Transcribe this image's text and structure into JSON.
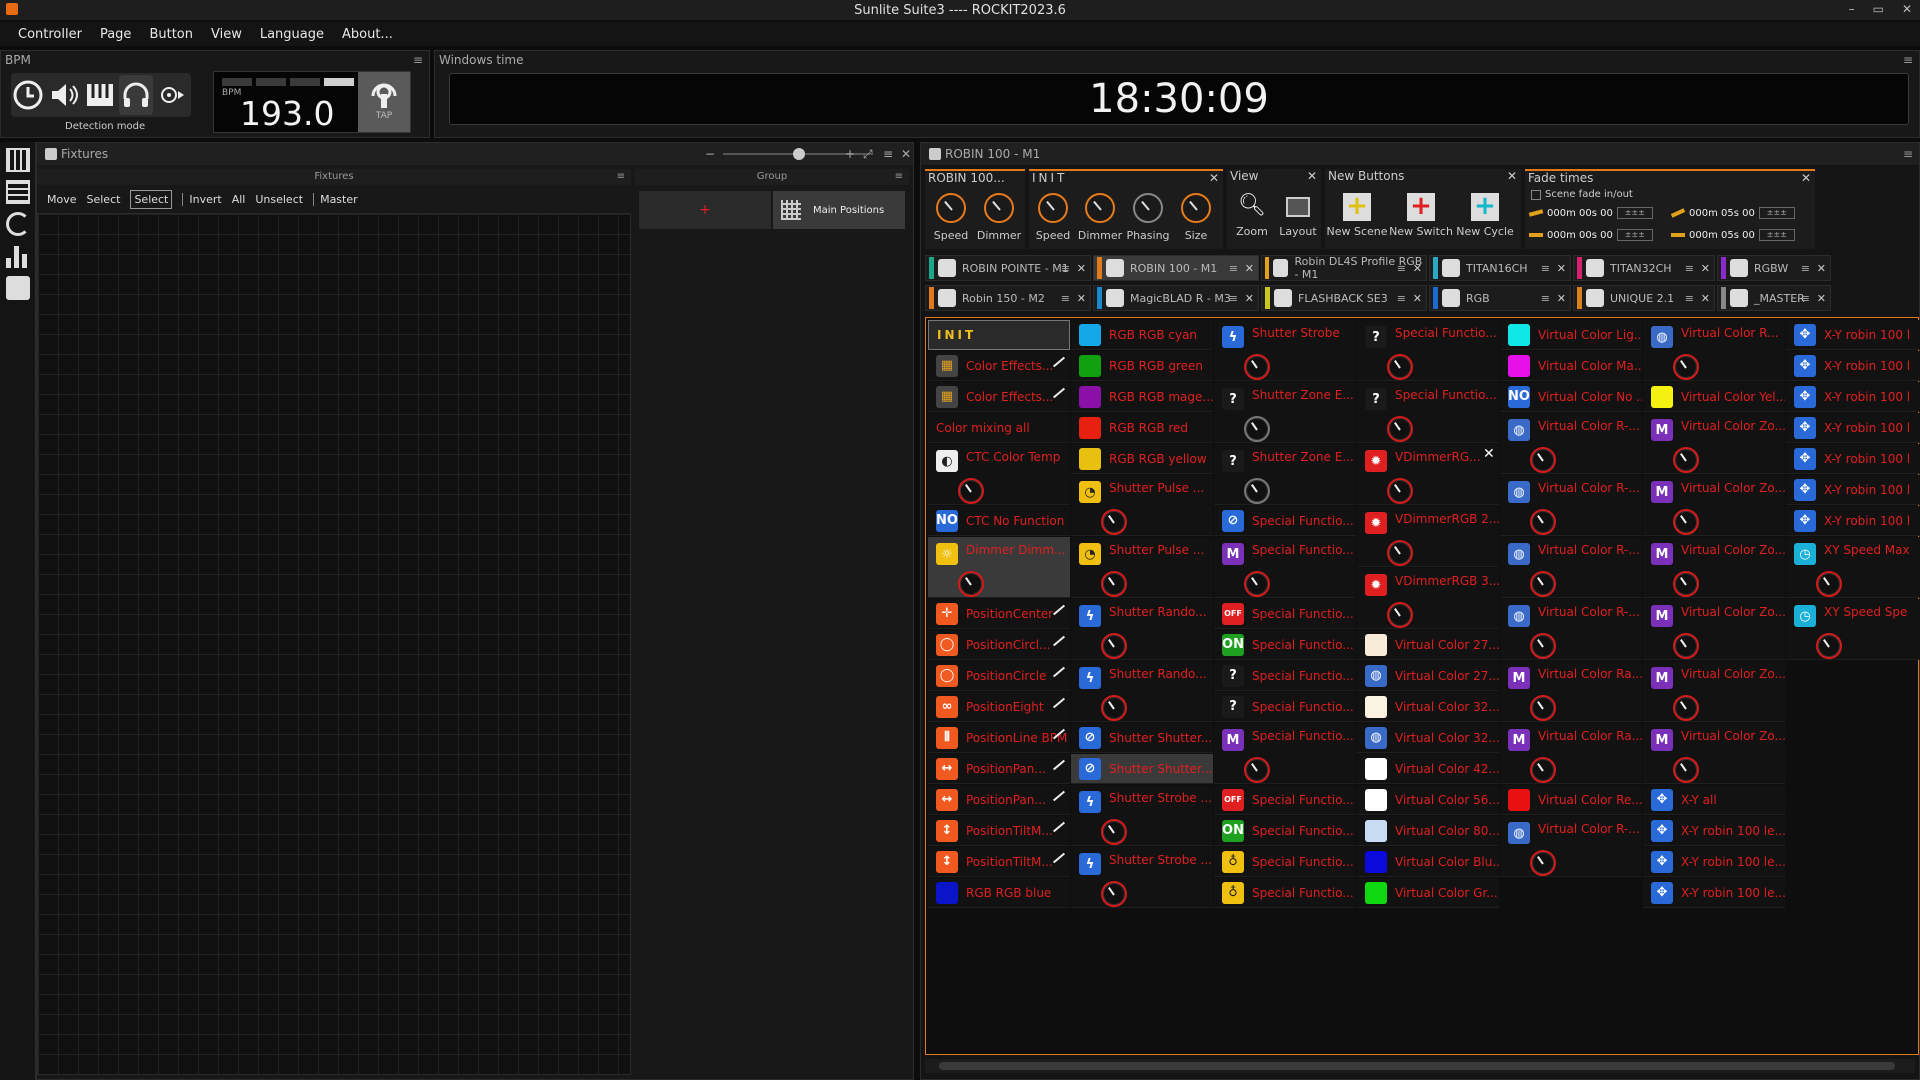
{
  "window": {
    "title": "Sunlite Suite3 ---- ROCKIT2023.6",
    "controls": [
      "–",
      "▭",
      "✕"
    ]
  },
  "menu": [
    "Controller",
    "Page",
    "Button",
    "View",
    "Language",
    "About..."
  ],
  "bpm": {
    "title": "BPM",
    "value": "193.0",
    "small_label": "BPM",
    "detection_label": "Detection mode",
    "tap": "TAP"
  },
  "clock": {
    "title": "Windows time",
    "time": "18:30:09"
  },
  "fixtures": {
    "title": "Fixtures",
    "grid_title": "Fixtures",
    "group_title": "Group",
    "toolbar": [
      "Move",
      "Select",
      "Select",
      "Invert",
      "All",
      "Unselect",
      "Master"
    ],
    "group_button": "Main Positions",
    "group_plus": "+",
    "zoom_minus": "−",
    "zoom_plus": "+"
  },
  "robin": {
    "title": "ROBIN 100 - M1"
  },
  "sections": [
    {
      "title": "ROBIN 100...",
      "knobs": [
        "Speed",
        "Dimmer"
      ]
    },
    {
      "title": "INIT",
      "knobs": [
        "Speed",
        "Dimmer",
        "Phasing",
        "Size"
      ]
    },
    {
      "title": "View",
      "knobs": [
        "Zoom",
        "Layout"
      ]
    },
    {
      "title": "New Buttons",
      "knobs": [
        "New Scene",
        "New Switch",
        "New Cycle"
      ]
    },
    {
      "title": "Fade times",
      "scene_fade": "Scene fade in/out",
      "times": [
        "000m 00s 00",
        "000m 05s 00",
        "000m 00s 00",
        "000m 05s 00"
      ]
    }
  ],
  "tabs_row1": [
    {
      "label": "ROBIN POINTE - M1",
      "color": "#1aa88a"
    },
    {
      "label": "ROBIN 100 - M1",
      "color": "#e07a1a"
    },
    {
      "label": "Robin DL4S Profile RGB - M1",
      "color": "#e0a01a"
    },
    {
      "label": "TITAN16CH",
      "color": "#2aa8c8"
    },
    {
      "label": "TITAN32CH",
      "color": "#d82070"
    },
    {
      "label": "RGBW",
      "color": "#8a2ad0"
    }
  ],
  "tabs_row2": [
    {
      "label": "Robin 150 - M2",
      "color": "#e07a1a"
    },
    {
      "label": "MagicBLAD R - M3",
      "color": "#1a8ad0"
    },
    {
      "label": "FLASHBACK SE3",
      "color": "#c8c820"
    },
    {
      "label": "RGB",
      "color": "#1a6ad0"
    },
    {
      "label": "UNIQUE 2.1",
      "color": "#d8801a"
    },
    {
      "label": "_MASTER",
      "color": "#888888"
    }
  ],
  "col1": [
    {
      "label": "INIT",
      "type": "init"
    },
    {
      "label": "Color Effects...",
      "icon": "grid-icon",
      "pen": true
    },
    {
      "label": "Color Effects...",
      "icon": "grid-icon",
      "pen": true
    },
    {
      "label": "Color mixing all"
    },
    {
      "label": "CTC Color Temp",
      "icon": "ctc-icon",
      "knob": true
    },
    {
      "label": "CTC No Function",
      "icon": "no-func-icon"
    },
    {
      "label": "Dimmer Dimm...",
      "icon": "dimmer-icon",
      "knob": true,
      "hi": true
    },
    {
      "label": "PositionCenter",
      "icon": "position-icon",
      "pen": true
    },
    {
      "label": "PositionCircl...",
      "icon": "circle-icon",
      "pen": true
    },
    {
      "label": "PositionCircle",
      "icon": "circle-icon",
      "pen": true
    },
    {
      "label": "PositionEight",
      "icon": "eight-icon",
      "pen": true
    },
    {
      "label": "PositionLine BPM",
      "icon": "line-icon",
      "pen": true
    },
    {
      "label": "PositionPan...",
      "icon": "pan-icon",
      "pen": true
    },
    {
      "label": "PositionPan...",
      "icon": "pan-icon",
      "pen": true
    },
    {
      "label": "PositionTiltM...",
      "icon": "tilt-icon",
      "pen": true
    },
    {
      "label": "PositionTiltM...",
      "icon": "tilt-icon",
      "pen": true
    },
    {
      "label": "RGB RGB blue",
      "icon": "swatch-icon",
      "color": "#0a14c8"
    }
  ],
  "col2": [
    {
      "label": "RGB RGB cyan",
      "color": "#14a8e8"
    },
    {
      "label": "RGB RGB green",
      "color": "#10a010"
    },
    {
      "label": "RGB RGB mage...",
      "color": "#8a10a8"
    },
    {
      "label": "RGB RGB red",
      "color": "#e82010"
    },
    {
      "label": "RGB RGB yellow",
      "color": "#e8c010"
    },
    {
      "label": "Shutter Pulse ...",
      "icon": "pulse-icon",
      "knob": true
    },
    {
      "label": "Shutter Pulse ...",
      "icon": "pulse-icon",
      "knob": true
    },
    {
      "label": "Shutter Rando...",
      "icon": "strobe-icon",
      "knob": true
    },
    {
      "label": "Shutter Rando...",
      "icon": "strobe-icon",
      "knob": true
    },
    {
      "label": "Shutter Shutter...",
      "icon": "shutter-icon"
    },
    {
      "label": "Shutter Shutter...",
      "icon": "shutter-icon",
      "hi": true
    },
    {
      "label": "Shutter Strobe ...",
      "icon": "strobe-icon",
      "knob": true
    },
    {
      "label": "Shutter Strobe ...",
      "icon": "strobe-icon",
      "knob": true
    }
  ],
  "col3": [
    {
      "label": "Shutter Strobe",
      "icon": "strobe-icon",
      "knob": true
    },
    {
      "label": "Shutter Zone E...",
      "icon": "question-icon",
      "knob": true
    },
    {
      "label": "Shutter Zone E...",
      "icon": "question-icon",
      "knob": true
    },
    {
      "label": "Special Functio...",
      "icon": "special-icon"
    },
    {
      "label": "Special Functio...",
      "icon": "macro-icon",
      "knob": true
    },
    {
      "label": "Special Functio...",
      "icon": "off-icon"
    },
    {
      "label": "Special Functio...",
      "icon": "on-icon"
    },
    {
      "label": "Special Functio...",
      "icon": "question-icon"
    },
    {
      "label": "Special Functio...",
      "icon": "question-icon"
    },
    {
      "label": "Special Functio...",
      "icon": "macro-icon",
      "knob": true
    },
    {
      "label": "Special Functio...",
      "icon": "off-icon"
    },
    {
      "label": "Special Functio...",
      "icon": "on-icon"
    },
    {
      "label": "Special Functio...",
      "icon": "bulb-icon"
    },
    {
      "label": "Special Functio...",
      "icon": "bulb-icon"
    }
  ],
  "col4": [
    {
      "label": "Special Functio...",
      "icon": "question-icon",
      "knob": true
    },
    {
      "label": "Special Functio...",
      "icon": "question-icon",
      "knob": true
    },
    {
      "label": "VDimmerRG...",
      "icon": "dimmer-red-icon",
      "knob": true,
      "close": true
    },
    {
      "label": "VDimmerRGB 2...",
      "icon": "dimmer-red-icon",
      "knob": true
    },
    {
      "label": "VDimmerRGB 3...",
      "icon": "dimmer-red-icon",
      "knob": true
    },
    {
      "label": "Virtual Color 27...",
      "color": "#f6ecd8"
    },
    {
      "label": "Virtual Color 27...",
      "icon": "color-icon"
    },
    {
      "label": "Virtual Color 32...",
      "color": "#fbf3e2"
    },
    {
      "label": "Virtual Color 32...",
      "icon": "color-icon"
    },
    {
      "label": "Virtual Color 42...",
      "color": "#ffffff"
    },
    {
      "label": "Virtual Color 56...",
      "color": "#ffffff"
    },
    {
      "label": "Virtual Color 80...",
      "color": "#c8dcf4"
    },
    {
      "label": "Virtual Color Blu...",
      "color": "#0a0adc"
    },
    {
      "label": "Virtual Color Gr...",
      "color": "#10d810"
    }
  ],
  "col5": [
    {
      "label": "Virtual Color Lig...",
      "color": "#10e8e8"
    },
    {
      "label": "Virtual Color Ma...",
      "color": "#e810e8"
    },
    {
      "label": "Virtual Color No ...",
      "icon": "no-func-icon"
    },
    {
      "label": "Virtual Color R-...",
      "icon": "color-icon",
      "knob": true
    },
    {
      "label": "Virtual Color R-...",
      "icon": "color-icon",
      "knob": true
    },
    {
      "label": "Virtual Color R-...",
      "icon": "color-icon",
      "knob": true
    },
    {
      "label": "Virtual Color R-...",
      "icon": "color-icon",
      "knob": true
    },
    {
      "label": "Virtual Color Ra...",
      "icon": "macro-icon",
      "knob": true
    },
    {
      "label": "Virtual Color Ra...",
      "icon": "macro-icon",
      "knob": true
    },
    {
      "label": "Virtual Color Re...",
      "color": "#e81010"
    },
    {
      "label": "Virtual Color R-...",
      "icon": "color-icon",
      "knob": true
    }
  ],
  "col6": [
    {
      "label": "Virtual Color R...",
      "icon": "color-icon",
      "knob": true
    },
    {
      "label": "Virtual Color Yel...",
      "color": "#f4f010"
    },
    {
      "label": "Virtual Color Zo...",
      "icon": "macro-icon",
      "knob": true
    },
    {
      "label": "Virtual Color Zo...",
      "icon": "macro-icon",
      "knob": true
    },
    {
      "label": "Virtual Color Zo...",
      "icon": "macro-icon",
      "knob": true
    },
    {
      "label": "Virtual Color Zo...",
      "icon": "macro-icon",
      "knob": true
    },
    {
      "label": "Virtual Color Zo...",
      "icon": "macro-icon",
      "knob": true
    },
    {
      "label": "Virtual Color Zo...",
      "icon": "macro-icon",
      "knob": true
    },
    {
      "label": "X-Y all",
      "icon": "xy-icon"
    },
    {
      "label": "X-Y robin 100 le...",
      "icon": "xy-icon"
    },
    {
      "label": "X-Y robin 100 le...",
      "icon": "xy-icon"
    },
    {
      "label": "X-Y robin 100 le...",
      "icon": "xy-icon"
    }
  ],
  "col7": [
    {
      "label": "X-Y robin 100 l",
      "icon": "xy-icon"
    },
    {
      "label": "X-Y robin 100 l",
      "icon": "xy-icon"
    },
    {
      "label": "X-Y robin 100 l",
      "icon": "xy-icon"
    },
    {
      "label": "X-Y robin 100 l",
      "icon": "xy-icon"
    },
    {
      "label": "X-Y robin 100 l",
      "icon": "xy-icon"
    },
    {
      "label": "X-Y robin 100 l",
      "icon": "xy-icon"
    },
    {
      "label": "X-Y robin 100 l",
      "icon": "xy-icon"
    },
    {
      "label": "XY Speed Max",
      "icon": "speed-icon",
      "knob": true
    },
    {
      "label": "XY Speed Spe",
      "icon": "speed-icon",
      "knob": true
    }
  ]
}
